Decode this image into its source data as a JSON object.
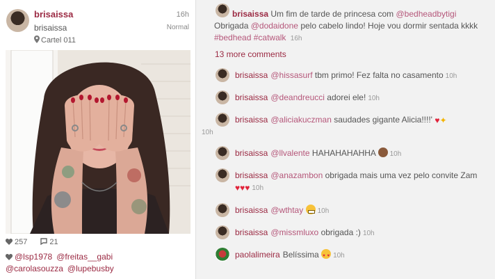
{
  "post": {
    "username": "brisaissa",
    "fullname": "brisaissa",
    "time": "16h",
    "filter": "Normal",
    "location": "Cartel 011",
    "likes": "257",
    "comments_count": "21",
    "tagged_users": [
      "@lsp1978",
      "@freitas__gabi",
      "@carolasouzza",
      "@lupebusby"
    ]
  },
  "caption": {
    "username": "brisaissa",
    "text_before": "Um fim de tarde de princesa com",
    "mention1": "@bedheadbytigi",
    "text_mid1": "Obrigada",
    "mention2": "@dodaidone",
    "text_mid2": "pelo cabelo lindo! Hoje vou dormir sentada kkkk",
    "hashtag1": "#bedhead",
    "hashtag2": "#catwalk",
    "time": "16h"
  },
  "more_comments": "13 more comments",
  "comments": [
    {
      "user": "brisaissa",
      "mention": "@hissasurf",
      "text": "tbm primo! Fez falta no casamento",
      "time": "10h"
    },
    {
      "user": "brisaissa",
      "mention": "@deandreucci",
      "text": "adorei ele!",
      "time": "10h"
    },
    {
      "user": "brisaissa",
      "mention": "@aliciakuczman",
      "text": "saudades gigante Alicia!!!!'",
      "time": "10h"
    },
    {
      "user": "brisaissa",
      "mention": "@llvalente",
      "text": "HAHAHAHAHHA",
      "time": "10h"
    },
    {
      "user": "brisaissa",
      "mention": "@anazambon",
      "text": "obrigada mais uma vez pelo convite Zam",
      "time": "10h"
    },
    {
      "user": "brisaissa",
      "mention": "@wthtay",
      "text": "",
      "time": "10h"
    },
    {
      "user": "brisaissa",
      "mention": "@missmluxo",
      "text": "obrigada :)",
      "time": "10h"
    },
    {
      "user": "paolalimeira",
      "mention": "",
      "text": "Belíssima",
      "time": "10h"
    }
  ],
  "colors": {
    "username": "#9b2a43",
    "link": "#b5577a",
    "heart": "#e0233a"
  }
}
